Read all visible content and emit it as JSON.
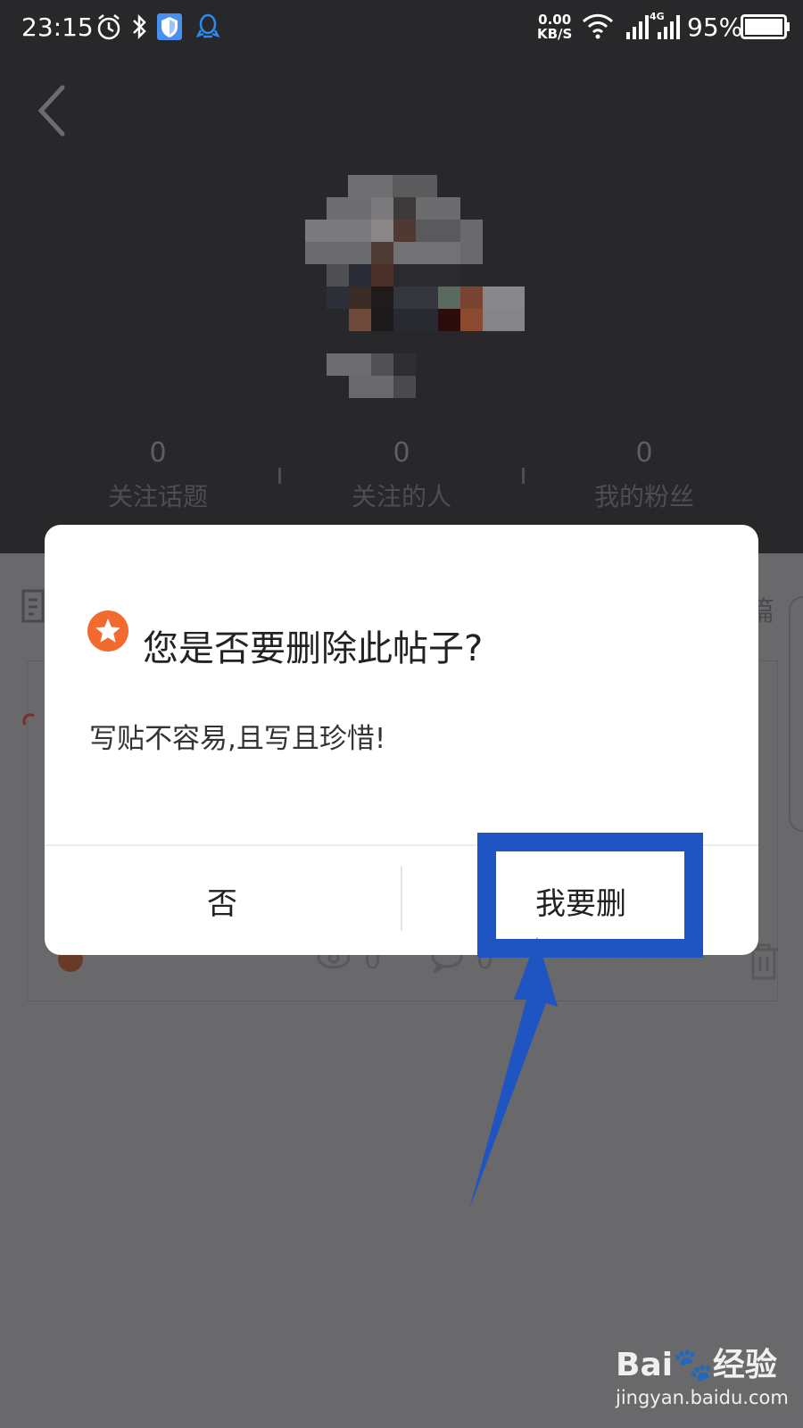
{
  "statusbar": {
    "time": "23:15",
    "net_speed_value": "0.00",
    "net_speed_unit": "KB/S",
    "signal_label": "4G",
    "battery_percent": "95%"
  },
  "profile": {
    "stats": [
      {
        "count": "0",
        "label": "关注话题"
      },
      {
        "count": "0",
        "label": "关注的人"
      },
      {
        "count": "0",
        "label": "我的粉丝"
      }
    ]
  },
  "background": {
    "right_char": "篇",
    "like_count": "0",
    "comment_count": "0"
  },
  "dialog": {
    "title": "您是否要删除此帖子?",
    "message": "写贴不容易,且写且珍惜!",
    "cancel_label": "否",
    "confirm_label": "我要删"
  },
  "watermark": {
    "logo": "Bai🐾经验",
    "url": "jingyan.baidu.com"
  },
  "colors": {
    "highlight": "#1e55c3",
    "star_badge": "#f26a2e",
    "header_bg": "#282729",
    "overlay_bg": "#69686b"
  }
}
